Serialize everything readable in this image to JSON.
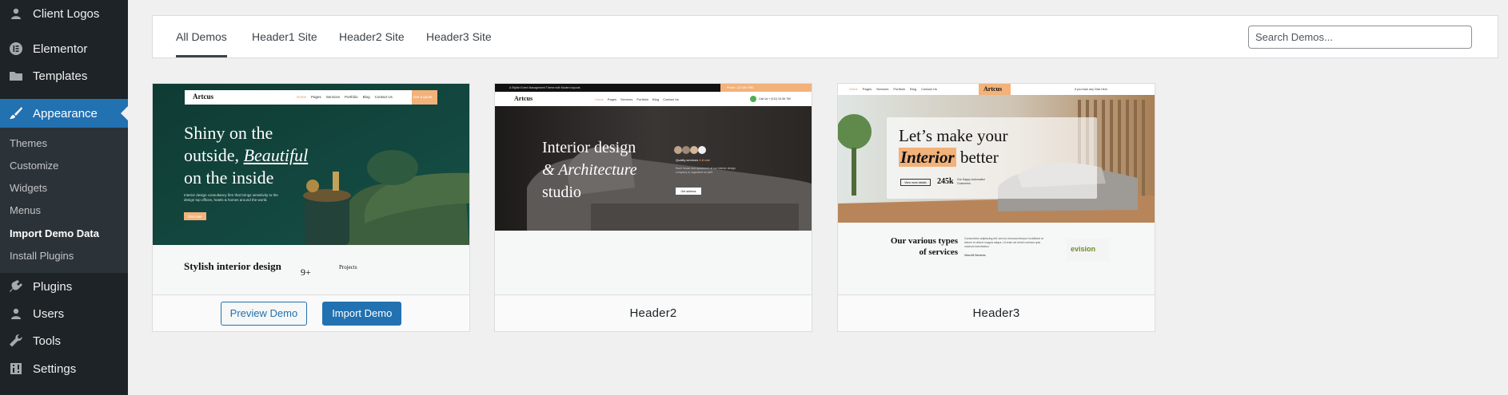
{
  "sidebar": {
    "items": [
      {
        "label": "Client Logos",
        "icon": "user-icon"
      },
      {
        "label": "Elementor",
        "icon": "elementor-icon"
      },
      {
        "label": "Templates",
        "icon": "folder-icon"
      },
      {
        "label": "Appearance",
        "icon": "brush-icon"
      },
      {
        "label": "Plugins",
        "icon": "plug-icon"
      },
      {
        "label": "Users",
        "icon": "user-icon"
      },
      {
        "label": "Tools",
        "icon": "wrench-icon"
      },
      {
        "label": "Settings",
        "icon": "settings-icon"
      }
    ],
    "submenu": [
      "Themes",
      "Customize",
      "Widgets",
      "Menus",
      "Import Demo Data",
      "Install Plugins"
    ],
    "current_submenu": "Import Demo Data",
    "active_item": "Appearance"
  },
  "tabs": [
    "All Demos",
    "Header1 Site",
    "Header2 Site",
    "Header3 Site"
  ],
  "active_tab": "All Demos",
  "search": {
    "placeholder": "Search Demos..."
  },
  "cards": [
    {
      "preview_label": "Preview Demo",
      "import_label": "Import Demo",
      "thumb": {
        "brand": "Artcus",
        "nav": [
          "Home",
          "Pages",
          "Services",
          "Portfolio",
          "Blog",
          "Contact Us"
        ],
        "cta": "Get a quote",
        "headline_1": "Shiny on the",
        "headline_2a": "outside, ",
        "headline_2b": "Beautiful",
        "headline_3": "on the inside",
        "body": "Interior design consultancy firm that brings sensitivity to the design top offices, hotels & homes around the world.",
        "button": "Discover",
        "section_title": "Stylish interior design",
        "stat": "9+",
        "stat_label": "Projects"
      }
    },
    {
      "title": "Header2",
      "thumb": {
        "topbar_left": "A Stylish Event Management Theme with Modern layouts",
        "topbar_right": "Phone: 123 456 7890",
        "brand": "Artcus",
        "nav": [
          "Home",
          "Pages",
          "Services",
          "Portfolio",
          "Blog",
          "Contact Us"
        ],
        "phone": "Call Us + (012) 34 56 789",
        "headline_1": "Interior design",
        "headline_2a": "& ",
        "headline_2b": "Architecture",
        "headline_3": "studio",
        "badge": "Quality services",
        "badge_score": "4.8 rate",
        "body": "Each house and apartment at our interior design company is organized so well.",
        "button": "Get address"
      }
    },
    {
      "title": "Header3",
      "thumb": {
        "brand": "Artcus",
        "nav": [
          "Home",
          "Pages",
          "Services",
          "Portfolio",
          "Blog",
          "Contact Us"
        ],
        "contact": "If you have any Click Here",
        "headline_1": "Let’s make your",
        "headline_2a": "Interior",
        "headline_2b": " better",
        "button": "View more details",
        "stat": "245k",
        "stat_label": "Our Happy Automated Customers",
        "section_title_1": "Our various types",
        "section_title_2": "of services",
        "section_body": "Consectetur adipiscing elit, sed do eiusmod tempor incididunt ut labore et dolore magna aliqua. Ut enim ad minim veniam quis nostrud exercitation.",
        "section_link": "View All Services",
        "logo": "evision"
      }
    }
  ],
  "colors": {
    "sidebar_bg": "#1d2327",
    "submenu_bg": "#2c3338",
    "accent": "#2271b1",
    "page_bg": "#f0f0f1",
    "demo_orange": "#f2b27a"
  }
}
